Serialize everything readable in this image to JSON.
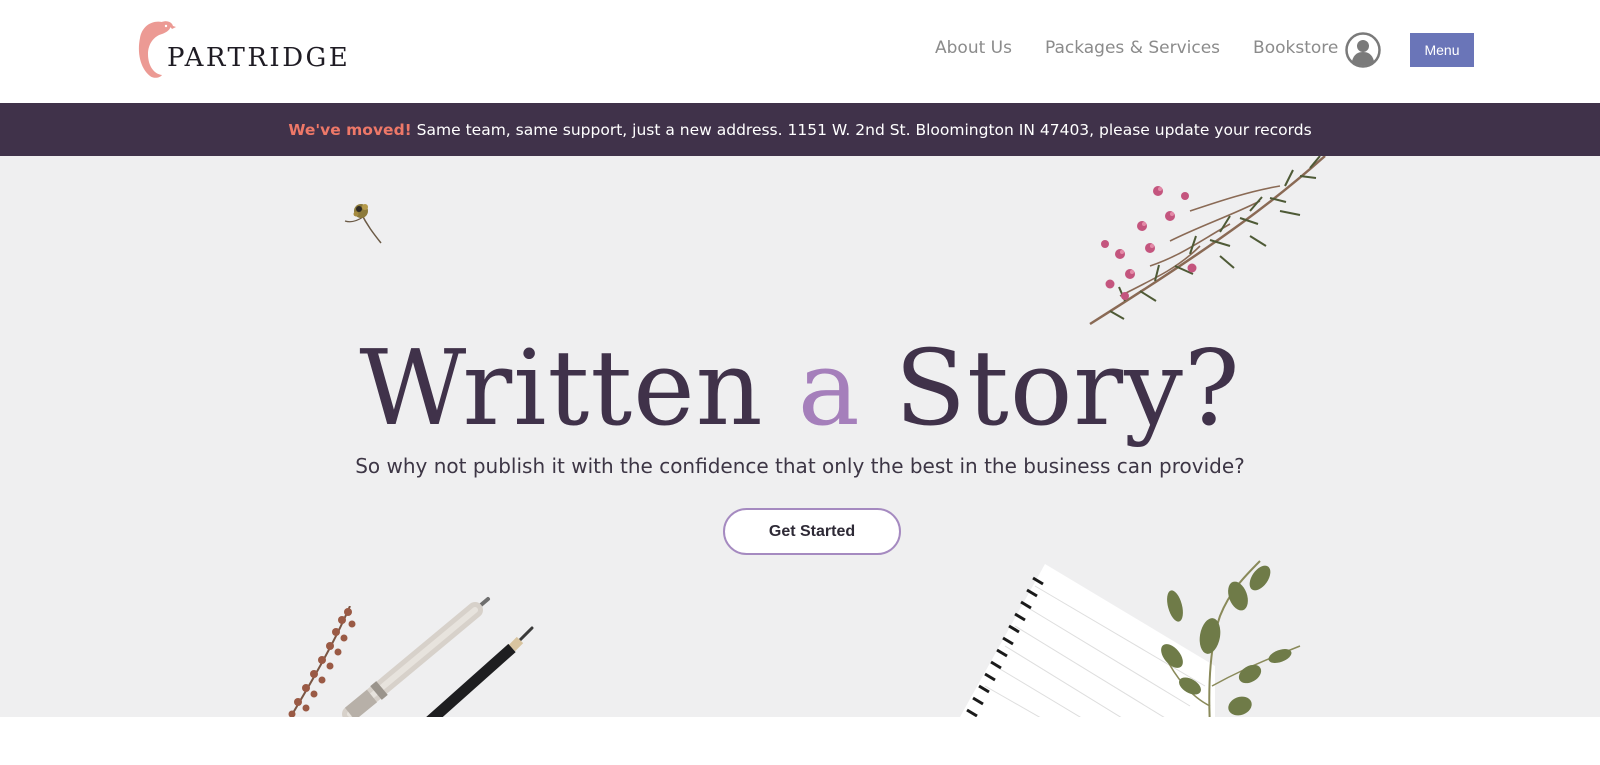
{
  "header": {
    "logo_text": "PARTRIDGE",
    "nav": [
      {
        "label": "About Us"
      },
      {
        "label": "Packages & Services"
      },
      {
        "label": "Bookstore"
      }
    ],
    "user_icon": "user-circle-icon",
    "menu_label": "Menu"
  },
  "banner": {
    "highlight": "We've moved!",
    "message": " Same team, same support, just a new address. 1151 W. 2nd St. Bloomington IN 47403, please update your records"
  },
  "hero": {
    "title_part1": "Written ",
    "title_accent": "a",
    "title_part2": " Story?",
    "subtitle": "So why not publish it with the confidence that only the best in the business can provide?",
    "cta_label": "Get Started"
  },
  "colors": {
    "brand_dark": "#40324a",
    "accent_purple": "#a57fbb",
    "banner_highlight": "#ee7868",
    "menu_button": "#6a75b8",
    "logo_pink": "#ec9a94"
  }
}
